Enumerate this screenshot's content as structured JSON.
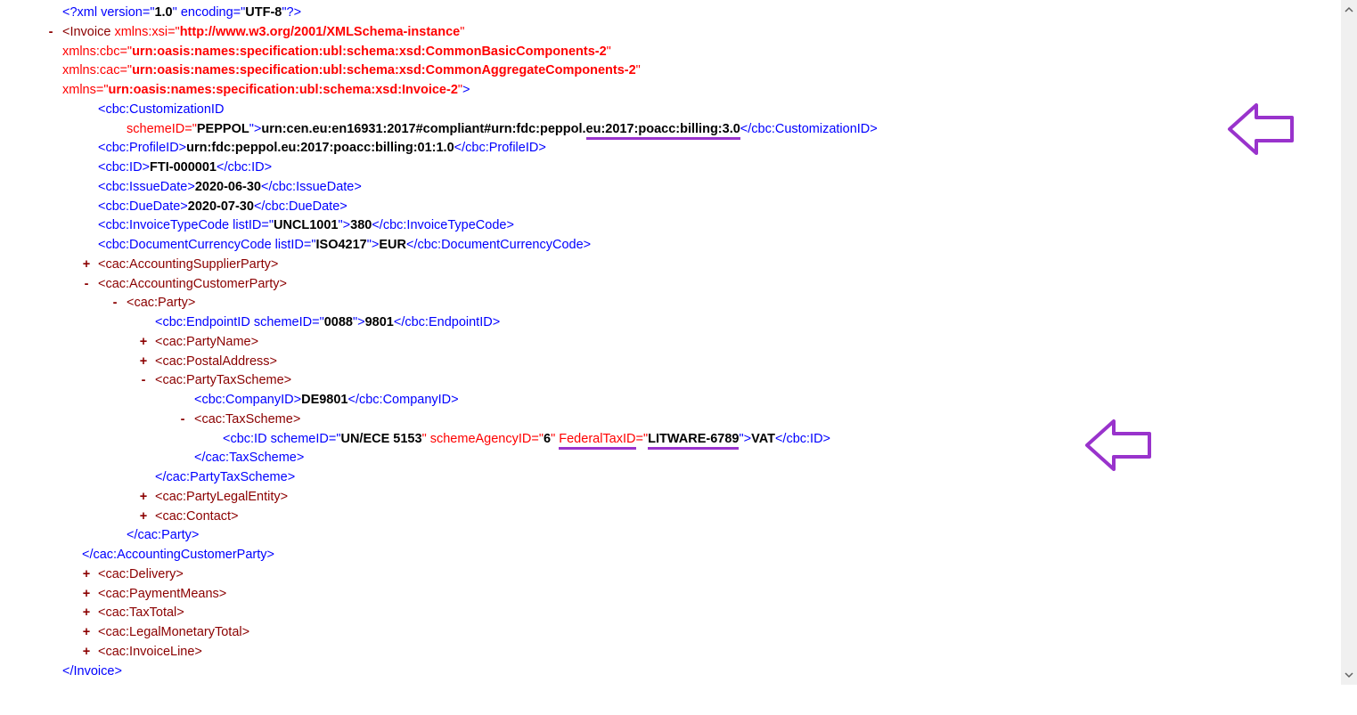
{
  "xml_decl": {
    "open": "<?xml version=\"",
    "v": "1.0",
    "mid": "\" encoding=\"",
    "enc": "UTF-8",
    "close": "\"?>"
  },
  "invoice": {
    "open": "<Invoice",
    "xsi_attr": " xmlns:xsi=\"",
    "xsi_val": "http://www.w3.org/2001/XMLSchema-instance",
    "cbc_attr": "xmlns:cbc=\"",
    "cbc_val": "urn:oasis:names:specification:ubl:schema:xsd:CommonBasicComponents-2",
    "cac_attr": "xmlns:cac=\"",
    "cac_val": "urn:oasis:names:specification:ubl:schema:xsd:CommonAggregateComponents-2",
    "xmlns_attr": "xmlns=\"",
    "xmlns_val": "urn:oasis:names:specification:ubl:schema:xsd:Invoice-2",
    "q": "\"",
    "gt": ">",
    "close": "</Invoice>"
  },
  "cust_id": {
    "open": "<cbc:CustomizationID",
    "attr": "schemeID=\"",
    "scheme": "PEPPOL",
    "g": "\">",
    "val1": "urn:cen.eu:en16931:2017#compliant#urn:fdc:peppol.",
    "val2": "eu:2017:poacc:billing:3.0",
    "close": "</cbc:CustomizationID>"
  },
  "profile": {
    "open": "<cbc:ProfileID>",
    "val": "urn:fdc:peppol.eu:2017:poacc:billing:01:1.0",
    "close": "</cbc:ProfileID>"
  },
  "id": {
    "open": "<cbc:ID>",
    "val": "FTI-000001",
    "close": "</cbc:ID>"
  },
  "issue": {
    "open": "<cbc:IssueDate>",
    "val": "2020-06-30",
    "close": "</cbc:IssueDate>"
  },
  "due": {
    "open": "<cbc:DueDate>",
    "val": "2020-07-30",
    "close": "</cbc:DueDate>"
  },
  "type_code": {
    "open": "<cbc:InvoiceTypeCode listID=\"",
    "list": "UNCL1001",
    "g": "\">",
    "val": "380",
    "close": "</cbc:InvoiceTypeCode>"
  },
  "currency": {
    "open": "<cbc:DocumentCurrencyCode listID=\"",
    "list": "ISO4217",
    "g": "\">",
    "val": "EUR",
    "close": "</cbc:DocumentCurrencyCode>"
  },
  "supplier": "<cac:AccountingSupplierParty>",
  "customer_open": "<cac:AccountingCustomerParty>",
  "customer_close": "</cac:AccountingCustomerParty>",
  "party_open": "<cac:Party>",
  "party_close": "</cac:Party>",
  "endpoint": {
    "open": "<cbc:EndpointID schemeID=\"",
    "scheme": "0088",
    "g": "\">",
    "val": "9801",
    "close": "</cbc:EndpointID>"
  },
  "party_name": "<cac:PartyName>",
  "postal": "<cac:PostalAddress>",
  "tax_scheme_open": "<cac:PartyTaxScheme>",
  "tax_scheme_close": "</cac:PartyTaxScheme>",
  "company_id": {
    "open": "<cbc:CompanyID>",
    "val": "DE9801",
    "close": "</cbc:CompanyID>"
  },
  "tax_inner_open": "<cac:TaxScheme>",
  "tax_inner_close": "</cac:TaxScheme>",
  "tax_id": {
    "open": "<cbc:ID schemeID=\"",
    "scheme": "UN/ECE 5153",
    "a2": "\" schemeAgencyID=\"",
    "agency": "6",
    "a3pre": "\" ",
    "a3name": "FederalTaxID",
    "a3eq": "=\"",
    "fedval": "LITWARE-6789",
    "g": "\">",
    "val": "VAT",
    "close": "</cbc:ID>"
  },
  "legal_entity": "<cac:PartyLegalEntity>",
  "contact": "<cac:Contact>",
  "delivery": "<cac:Delivery>",
  "payment_means": "<cac:PaymentMeans>",
  "tax_total": "<cac:TaxTotal>",
  "legal_total": "<cac:LegalMonetaryTotal>",
  "invoice_line": "<cac:InvoiceLine>",
  "plus": "+",
  "minus": "-"
}
